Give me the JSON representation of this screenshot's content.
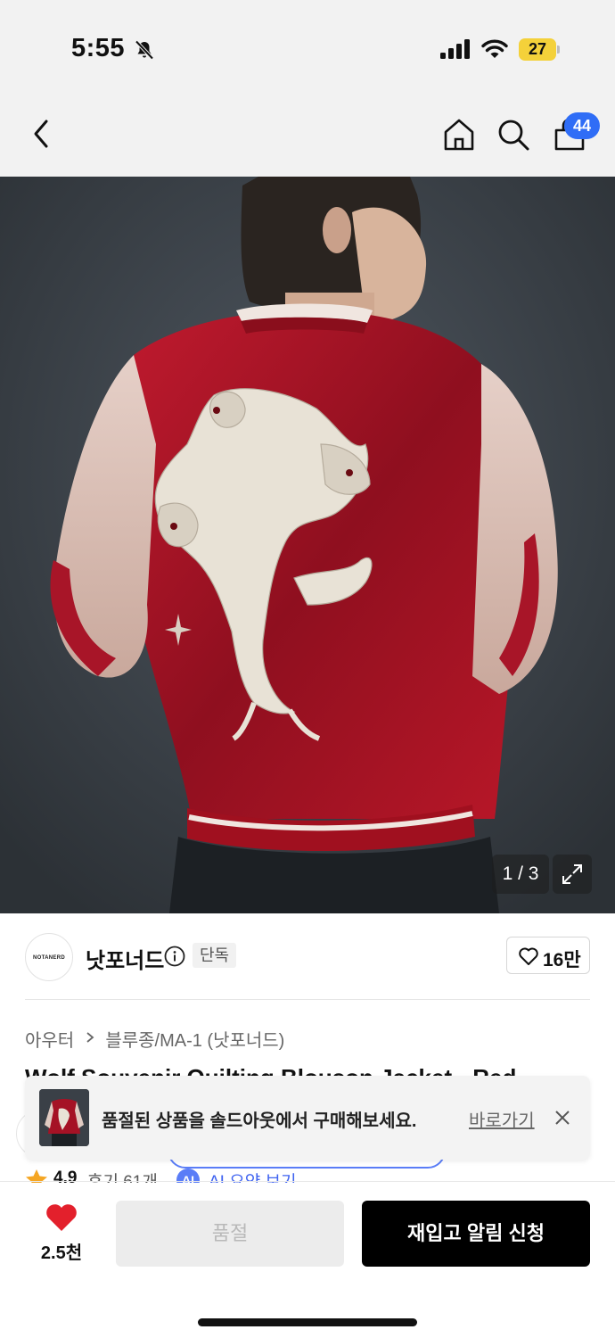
{
  "status_bar": {
    "time": "5:55",
    "battery": "27",
    "icons": [
      "bell-slash-icon",
      "signal-icon",
      "wifi-icon",
      "battery-icon"
    ]
  },
  "nav": {
    "icons": [
      "back-icon",
      "home-icon",
      "search-icon",
      "bag-icon"
    ],
    "cart_badge": "44"
  },
  "gallery": {
    "counter": "1 / 3",
    "expand_icon": "expand-icon"
  },
  "brand": {
    "logo_text": "NOTANERD",
    "name": "낫포너드",
    "badge": "단독",
    "like_count": "16만"
  },
  "breadcrumb": {
    "items": [
      "아우터",
      "블루종/MA-1 (낫포너드)"
    ]
  },
  "product": {
    "title": "Wolf Souvenir Quilting Blouson Jacket - Red"
  },
  "toast": {
    "message": "품절된 상품을 솔드아웃에서 구매해보세요.",
    "link": "바로가기"
  },
  "rating": {
    "value": "4.9",
    "reviews": "후기 61개",
    "ai_tag": "AI",
    "ai_summary": "AI 요약 보기"
  },
  "bottom_bar": {
    "wish_count": "2.5천",
    "soldout_label": "품절",
    "restock_label": "재입고 알림 신청"
  },
  "colors": {
    "badge_blue": "#2f6df6",
    "jacket_red": "#a51225",
    "wish_heart": "#e3202c",
    "ai_blue": "#5a7df7",
    "battery_yellow": "#f4d13a"
  }
}
